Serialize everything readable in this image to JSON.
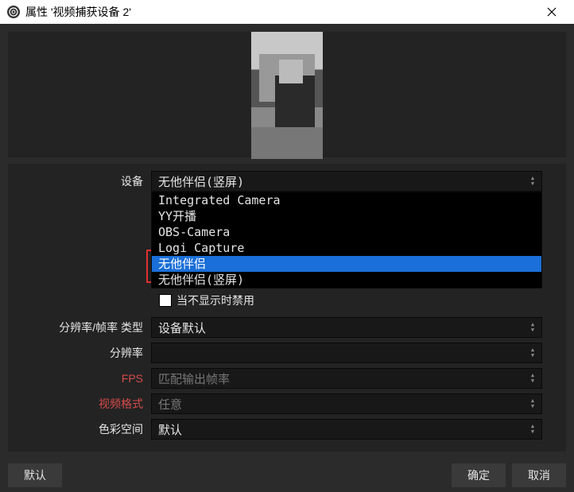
{
  "titlebar": {
    "title": "属性 '视频捕获设备 2'"
  },
  "labels": {
    "device": "设备",
    "disableWhenHidden": "当不显示时禁用",
    "resFpsType": "分辨率/帧率 类型",
    "resolution": "分辨率",
    "fps": "FPS",
    "videoFormat": "视频格式",
    "colorSpace": "色彩空间"
  },
  "values": {
    "device": "无他伴侣(竖屏)",
    "resFpsType": "设备默认",
    "resolution": "",
    "fps": "匹配输出帧率",
    "videoFormat": "任意",
    "colorSpace": "默认"
  },
  "dropdown": {
    "items": [
      {
        "label": "Integrated Camera",
        "hl": false
      },
      {
        "label": "YY开播",
        "hl": false
      },
      {
        "label": "OBS-Camera",
        "hl": false
      },
      {
        "label": "Logi Capture",
        "hl": false
      },
      {
        "label": "无他伴侣",
        "hl": true
      },
      {
        "label": "无他伴侣(竖屏)",
        "hl": false
      }
    ]
  },
  "buttons": {
    "defaults": "默认",
    "ok": "确定",
    "cancel": "取消"
  }
}
